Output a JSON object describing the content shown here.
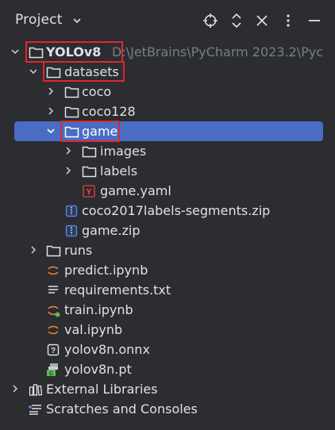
{
  "header": {
    "title": "Project",
    "icons": [
      "crosshair-icon",
      "expand-collapse-icon",
      "close-icon",
      "more-icon",
      "minimize-icon"
    ]
  },
  "tree": {
    "root": {
      "label": "YOLOv8",
      "path": "D:\\JetBrains\\PyCharm 2023.2\\Pyc"
    },
    "datasets": "datasets",
    "coco": "coco",
    "coco128": "coco128",
    "game": "game",
    "images": "images",
    "labels": "labels",
    "game_yaml": "game.yaml",
    "coco_zip": "coco2017labels-segments.zip",
    "game_zip": "game.zip",
    "runs": "runs",
    "predict": "predict.ipynb",
    "requirements": "requirements.txt",
    "train": "train.ipynb",
    "val": "val.ipynb",
    "onnx": "yolov8n.onnx",
    "pt": "yolov8n.pt",
    "external": "External Libraries",
    "scratches": "Scratches and Consoles"
  },
  "colors": {
    "background": "#2b2d30",
    "selection": "#4a6dc4",
    "highlight_box": "#e0262d",
    "text": "#dfe1e5",
    "path_text": "#7a7e85",
    "notebook_orange": "#e0813a"
  }
}
